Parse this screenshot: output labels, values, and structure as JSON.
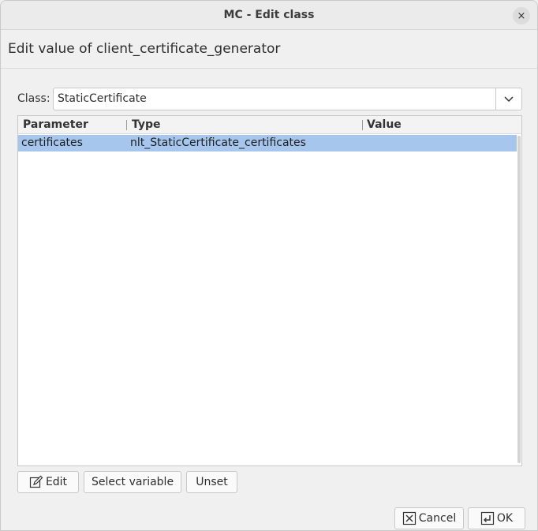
{
  "window": {
    "title": "MC - Edit class",
    "close_glyph": "×"
  },
  "header": {
    "text": "Edit value of client_certificate_generator"
  },
  "class_field": {
    "label": "Class:",
    "value": "StaticCertificate"
  },
  "table": {
    "columns": [
      "Parameter",
      "Type",
      "Value"
    ],
    "rows": [
      {
        "parameter": "certificates",
        "type": "nlt_StaticCertificate_certificates",
        "value": ""
      }
    ],
    "selection_color": "#a6c6ee"
  },
  "actions": {
    "edit_label": "Edit",
    "select_variable_label": "Select variable",
    "unset_label": "Unset"
  },
  "footer": {
    "cancel_label": "Cancel",
    "ok_label": "OK"
  },
  "icons": {
    "edit": "pencil-edit-icon",
    "cancel": "x-box-icon",
    "ok": "enter-return-icon",
    "dropdown": "chevron-down-icon"
  }
}
